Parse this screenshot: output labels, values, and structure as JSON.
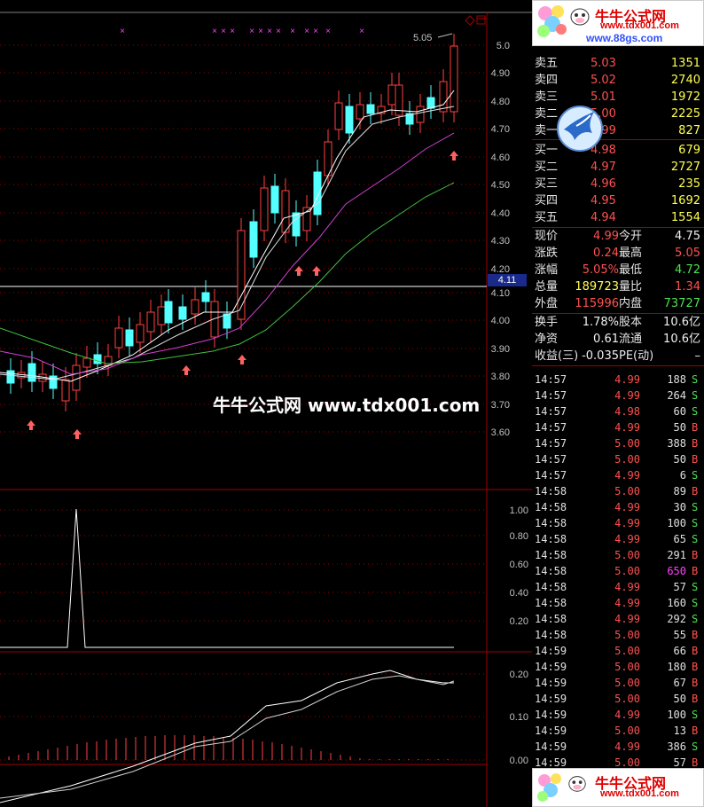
{
  "watermark": "牛牛公式网 www.tdx001.com",
  "logo_top": {
    "title": "牛牛公式网",
    "url": "www.tdx001.com",
    "url2": "www.88gs.com"
  },
  "logo_bottom": {
    "title": "牛牛公式网",
    "url": "www.tdx001.com"
  },
  "current_price_tag": "4.11",
  "high_annotation": "5.05",
  "colors": {
    "up": "#ff4040",
    "down": "#54ffff",
    "ma_fast": "#ffffff",
    "ma_mid": "#d040d0",
    "ma_slow": "#40c040",
    "grid_red": "#a00000"
  },
  "axes": {
    "main": [
      "5.0",
      "4.90",
      "4.80",
      "4.70",
      "4.60",
      "4.50",
      "4.40",
      "4.30",
      "4.20",
      "4.10",
      "4.00",
      "3.90",
      "3.80",
      "3.70",
      "3.60"
    ],
    "ind1": [
      "1.00",
      "0.80",
      "0.60",
      "0.40",
      "0.20"
    ],
    "ind2": [
      "0.20",
      "0.10",
      "0.00"
    ]
  },
  "order_book": {
    "sell": [
      {
        "label": "卖五",
        "price": "5.03",
        "vol": "1351"
      },
      {
        "label": "卖四",
        "price": "5.02",
        "vol": "2740"
      },
      {
        "label": "卖三",
        "price": "5.01",
        "vol": "1972"
      },
      {
        "label": "卖二",
        "price": "5.00",
        "vol": "2225"
      },
      {
        "label": "卖一",
        "price": "4.99",
        "vol": "827"
      }
    ],
    "buy": [
      {
        "label": "买一",
        "price": "4.98",
        "vol": "679"
      },
      {
        "label": "买二",
        "price": "4.97",
        "vol": "2727"
      },
      {
        "label": "买三",
        "price": "4.96",
        "vol": "235"
      },
      {
        "label": "买四",
        "price": "4.95",
        "vol": "1692"
      },
      {
        "label": "买五",
        "price": "4.94",
        "vol": "1554"
      }
    ]
  },
  "quote": {
    "xianjia": {
      "label": "现价",
      "value": "4.99"
    },
    "jinkai": {
      "label": "今开",
      "value": "4.75"
    },
    "zhangdie": {
      "label": "涨跌",
      "value": "0.24"
    },
    "zuigao": {
      "label": "最高",
      "value": "5.05"
    },
    "zhangfu": {
      "label": "涨幅",
      "value": "5.05%"
    },
    "zuidi": {
      "label": "最低",
      "value": "4.72"
    },
    "zongliang": {
      "label": "总量",
      "value": "189723"
    },
    "liangbi": {
      "label": "量比",
      "value": "1.34"
    },
    "waipan": {
      "label": "外盘",
      "value": "115996"
    },
    "neipan": {
      "label": "内盘",
      "value": "73727"
    },
    "huanshou": {
      "label": "换手",
      "value": "1.78%"
    },
    "guben": {
      "label": "股本",
      "value": "10.6亿"
    },
    "jingzi": {
      "label": "净资",
      "value": "0.61"
    },
    "liutong": {
      "label": "流通",
      "value": "10.6亿"
    },
    "shouyi": {
      "label": "收益(三)",
      "value": "-0.035"
    },
    "pe": {
      "label": "PE(动)",
      "value": "–"
    }
  },
  "ticks": [
    {
      "time": "14:57",
      "price": "4.99",
      "vol": "188",
      "dir": "S"
    },
    {
      "time": "14:57",
      "price": "4.99",
      "vol": "264",
      "dir": "S"
    },
    {
      "time": "14:57",
      "price": "4.98",
      "vol": "60",
      "dir": "S"
    },
    {
      "time": "14:57",
      "price": "4.99",
      "vol": "50",
      "dir": "B"
    },
    {
      "time": "14:57",
      "price": "5.00",
      "vol": "388",
      "dir": "B"
    },
    {
      "time": "14:57",
      "price": "5.00",
      "vol": "50",
      "dir": "B"
    },
    {
      "time": "14:57",
      "price": "4.99",
      "vol": "6",
      "dir": "S"
    },
    {
      "time": "14:58",
      "price": "5.00",
      "vol": "89",
      "dir": "B"
    },
    {
      "time": "14:58",
      "price": "4.99",
      "vol": "30",
      "dir": "S"
    },
    {
      "time": "14:58",
      "price": "4.99",
      "vol": "100",
      "dir": "S"
    },
    {
      "time": "14:58",
      "price": "4.99",
      "vol": "65",
      "dir": "S"
    },
    {
      "time": "14:58",
      "price": "5.00",
      "vol": "291",
      "dir": "B"
    },
    {
      "time": "14:58",
      "price": "5.00",
      "vol": "650",
      "dir": "B"
    },
    {
      "time": "14:58",
      "price": "4.99",
      "vol": "57",
      "dir": "S"
    },
    {
      "time": "14:58",
      "price": "4.99",
      "vol": "160",
      "dir": "S"
    },
    {
      "time": "14:58",
      "price": "4.99",
      "vol": "292",
      "dir": "S"
    },
    {
      "time": "14:58",
      "price": "5.00",
      "vol": "55",
      "dir": "B"
    },
    {
      "time": "14:59",
      "price": "5.00",
      "vol": "66",
      "dir": "B"
    },
    {
      "time": "14:59",
      "price": "5.00",
      "vol": "180",
      "dir": "B"
    },
    {
      "time": "14:59",
      "price": "5.00",
      "vol": "67",
      "dir": "B"
    },
    {
      "time": "14:59",
      "price": "5.00",
      "vol": "50",
      "dir": "B"
    },
    {
      "time": "14:59",
      "price": "4.99",
      "vol": "100",
      "dir": "S"
    },
    {
      "time": "14:59",
      "price": "5.00",
      "vol": "13",
      "dir": "B"
    },
    {
      "time": "14:59",
      "price": "4.99",
      "vol": "386",
      "dir": "S"
    },
    {
      "time": "14:59",
      "price": "5.00",
      "vol": "57",
      "dir": "B"
    }
  ]
}
